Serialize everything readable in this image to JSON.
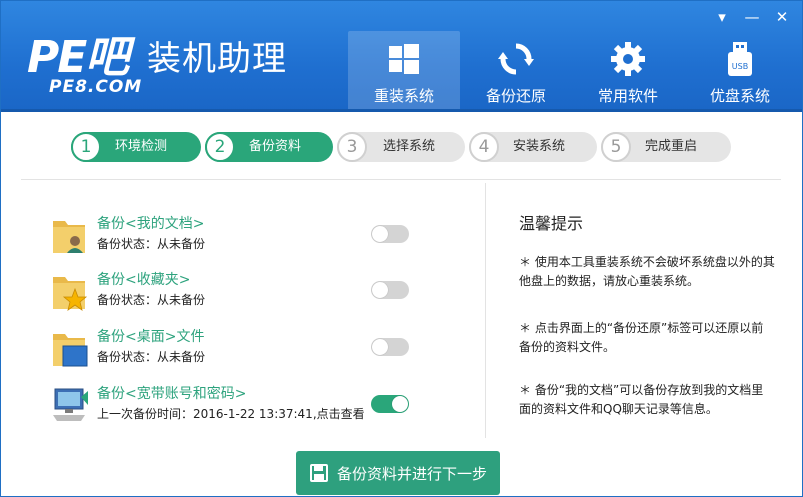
{
  "header": {
    "logo_pe": "PE吧",
    "logo_title": "装机助理",
    "logo_sub": "PE8.COM",
    "nav": [
      {
        "label": "重装系统",
        "icon": "windows-icon",
        "active": true
      },
      {
        "label": "备份还原",
        "icon": "sync-icon",
        "active": false
      },
      {
        "label": "常用软件",
        "icon": "gear-icon",
        "active": false
      },
      {
        "label": "优盘系统",
        "icon": "usb-icon",
        "active": false
      }
    ],
    "usb_text": "USB"
  },
  "window_controls": {
    "menu": "▾",
    "minimize": "—",
    "close": "✕"
  },
  "steps": [
    {
      "num": "1",
      "label": "环境检测",
      "state": "done"
    },
    {
      "num": "2",
      "label": "备份资料",
      "state": "done"
    },
    {
      "num": "3",
      "label": "选择系统",
      "state": "todo"
    },
    {
      "num": "4",
      "label": "安装系统",
      "state": "todo"
    },
    {
      "num": "5",
      "label": "完成重启",
      "state": "todo"
    }
  ],
  "backup_items": [
    {
      "title": "备份<我的文档>",
      "status": "备份状态：从未备份",
      "enabled": false,
      "icon": "documents-folder-icon"
    },
    {
      "title": "备份<收藏夹>",
      "status": "备份状态：从未备份",
      "enabled": false,
      "icon": "favorites-folder-icon"
    },
    {
      "title": "备份<桌面>文件",
      "status": "备份状态：从未备份",
      "enabled": false,
      "icon": "desktop-folder-icon"
    },
    {
      "title": "备份<宽带账号和密码>",
      "status": "上一次备份时间：2016-1-22 13:37:41,点击查看",
      "enabled": true,
      "icon": "network-computer-icon"
    }
  ],
  "tips": {
    "title": "温馨提示",
    "items": [
      "＊ 使用本工具重装系统不会破坏系统盘以外的其他盘上的数据，请放心重装系统。",
      "＊ 点击界面上的“备份还原”标签可以还原以前备份的资料文件。",
      "＊ 备份“我的文档”可以备份存放到我的文档里面的资料文件和QQ聊天记录等信息。"
    ]
  },
  "next_button": {
    "label": "备份资料并进行下一步"
  },
  "colors": {
    "header_blue": "#1f6fd0",
    "accent_green": "#2aa67a",
    "toggle_off": "#d4d4d4"
  }
}
